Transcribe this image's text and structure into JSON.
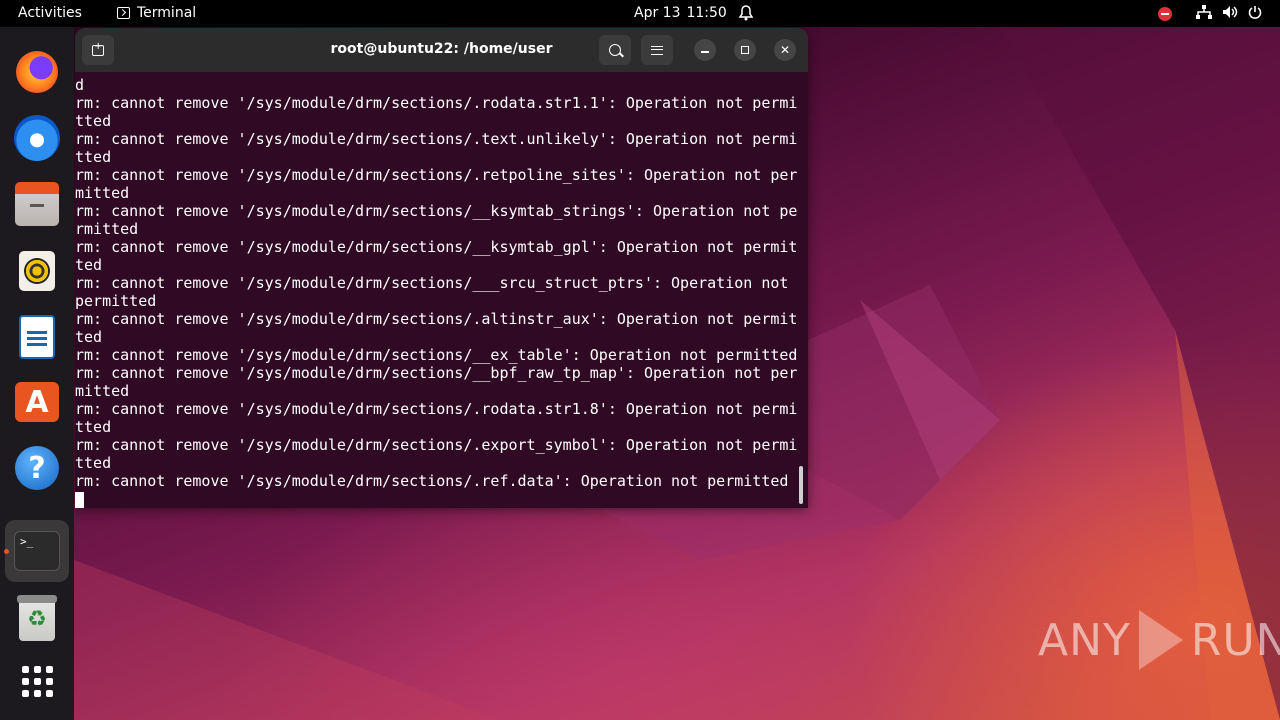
{
  "topbar": {
    "activities": "Activities",
    "app_name": "Terminal",
    "date": "Apr 13",
    "time": "11:50"
  },
  "dock": {
    "items": [
      {
        "name": "firefox",
        "icon": "firefox-icon"
      },
      {
        "name": "thunderbird",
        "icon": "thunderbird-icon"
      },
      {
        "name": "files",
        "icon": "files-icon"
      },
      {
        "name": "rhythmbox",
        "icon": "rhythmbox-icon"
      },
      {
        "name": "libreoffice-writer",
        "icon": "writer-icon"
      },
      {
        "name": "ubuntu-software",
        "icon": "app-store-icon"
      },
      {
        "name": "help",
        "icon": "help-icon"
      },
      {
        "name": "terminal",
        "icon": "terminal-icon"
      },
      {
        "name": "trash",
        "icon": "trash-icon"
      },
      {
        "name": "show-applications",
        "icon": "app-grid-icon"
      }
    ],
    "terminal_glyph": ">_",
    "help_glyph": "?",
    "store_glyph": "A",
    "trash_glyph": "♻"
  },
  "window": {
    "title": "root@ubuntu22: /home/user"
  },
  "terminal": {
    "lines": [
      "d",
      "rm: cannot remove '/sys/module/drm/sections/.rodata.str1.1': Operation not permi",
      "tted",
      "rm: cannot remove '/sys/module/drm/sections/.text.unlikely': Operation not permi",
      "tted",
      "rm: cannot remove '/sys/module/drm/sections/.retpoline_sites': Operation not per",
      "mitted",
      "rm: cannot remove '/sys/module/drm/sections/__ksymtab_strings': Operation not pe",
      "rmitted",
      "rm: cannot remove '/sys/module/drm/sections/__ksymtab_gpl': Operation not permit",
      "ted",
      "rm: cannot remove '/sys/module/drm/sections/___srcu_struct_ptrs': Operation not ",
      "permitted",
      "rm: cannot remove '/sys/module/drm/sections/.altinstr_aux': Operation not permit",
      "ted",
      "rm: cannot remove '/sys/module/drm/sections/__ex_table': Operation not permitted",
      "rm: cannot remove '/sys/module/drm/sections/__bpf_raw_tp_map': Operation not per",
      "mitted",
      "rm: cannot remove '/sys/module/drm/sections/.rodata.str1.8': Operation not permi",
      "tted",
      "rm: cannot remove '/sys/module/drm/sections/.export_symbol': Operation not permi",
      "tted",
      "rm: cannot remove '/sys/module/drm/sections/.ref.data': Operation not permitted"
    ]
  },
  "watermark": {
    "left": "ANY",
    "right": "RUN"
  },
  "colors": {
    "terminal_bg": "#300a24",
    "accent": "#e95420"
  }
}
